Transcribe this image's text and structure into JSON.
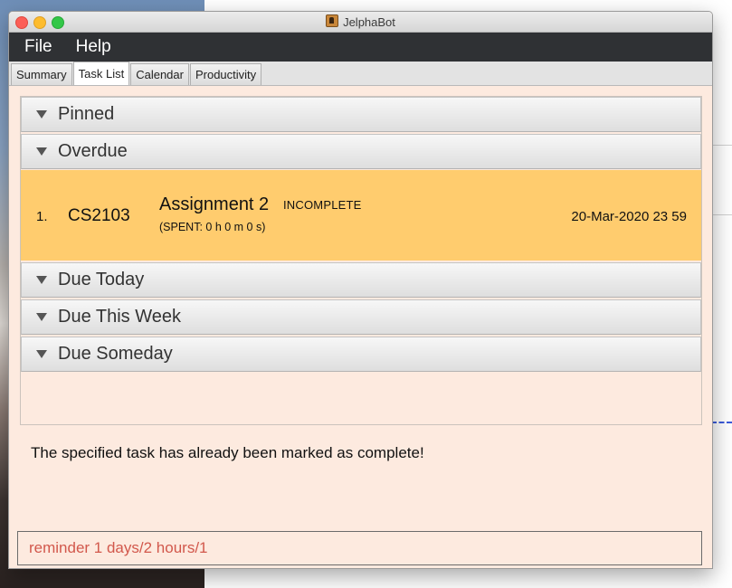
{
  "window": {
    "title": "JelphaBot"
  },
  "menu": {
    "items": [
      "File",
      "Help"
    ]
  },
  "tabs": [
    "Summary",
    "Task List",
    "Calendar",
    "Productivity"
  ],
  "active_tab": "Task List",
  "sections": {
    "pinned": "Pinned",
    "overdue": "Overdue",
    "due_today": "Due Today",
    "due_this_week": "Due This Week",
    "due_someday": "Due Someday"
  },
  "overdue_tasks": [
    {
      "index": "1.",
      "module": "CS2103",
      "description": "Assignment 2",
      "status": "INCOMPLETE",
      "time_spent": "(SPENT: 0 h 0 m 0 s)",
      "deadline": "20-Mar-2020 23 59"
    }
  ],
  "result": {
    "message": "The specified task has already been marked as complete!"
  },
  "command": {
    "value": "reminder 1 days/2 hours/1"
  },
  "colors": {
    "task_highlight": "#ffcc6e",
    "window_background": "#fdeadf",
    "menubar": "#2f3134",
    "command_text": "#d2584c"
  }
}
